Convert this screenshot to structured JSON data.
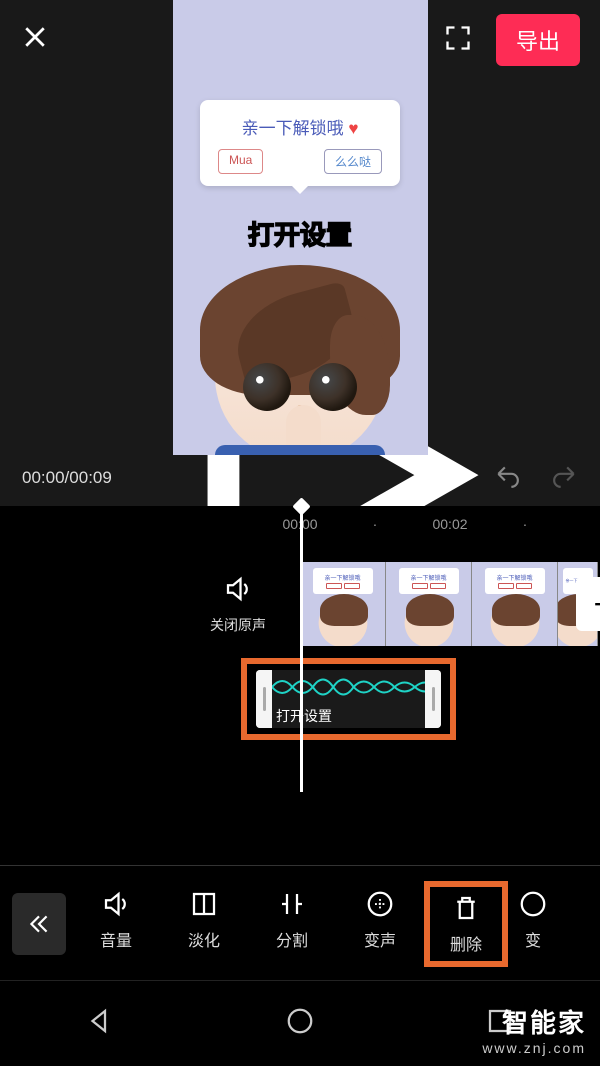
{
  "topbar": {
    "export_label": "导出"
  },
  "preview": {
    "speech_title": "亲一下解锁哦",
    "pill_left": "Mua",
    "pill_right": "么么哒",
    "caption": "打开设置"
  },
  "playback": {
    "current": "00:00",
    "total": "00:09"
  },
  "timeline": {
    "ruler": [
      "00:00",
      "00:02"
    ],
    "mute_label": "关闭原声",
    "thumb_title": "亲一下解锁哦",
    "clip_label": "打开设置",
    "add_symbol": "+"
  },
  "toolbar": {
    "items": [
      {
        "id": "volume",
        "label": "音量"
      },
      {
        "id": "fade",
        "label": "淡化"
      },
      {
        "id": "split",
        "label": "分割"
      },
      {
        "id": "voice",
        "label": "变声"
      },
      {
        "id": "delete",
        "label": "删除"
      },
      {
        "id": "speed",
        "label": "变"
      }
    ]
  },
  "watermark": {
    "main": "智能家",
    "sub": "www.znj.com"
  }
}
